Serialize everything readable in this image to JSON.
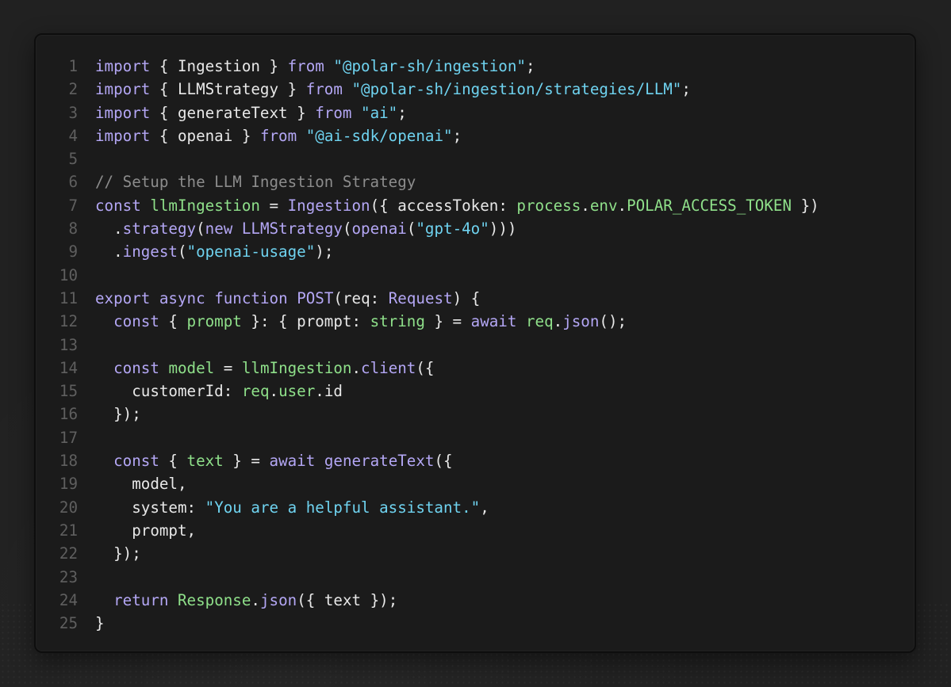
{
  "code": {
    "lines": [
      {
        "n": "1",
        "t": [
          [
            "kw",
            "import"
          ],
          [
            "pn",
            " { "
          ],
          [
            "ident",
            "Ingestion"
          ],
          [
            "pn",
            " } "
          ],
          [
            "kw",
            "from"
          ],
          [
            "pn",
            " "
          ],
          [
            "str",
            "\"@polar-sh/ingestion\""
          ],
          [
            "pn",
            ";"
          ]
        ]
      },
      {
        "n": "2",
        "t": [
          [
            "kw",
            "import"
          ],
          [
            "pn",
            " { "
          ],
          [
            "ident",
            "LLMStrategy"
          ],
          [
            "pn",
            " } "
          ],
          [
            "kw",
            "from"
          ],
          [
            "pn",
            " "
          ],
          [
            "str",
            "\"@polar-sh/ingestion/strategies/LLM\""
          ],
          [
            "pn",
            ";"
          ]
        ]
      },
      {
        "n": "3",
        "t": [
          [
            "kw",
            "import"
          ],
          [
            "pn",
            " { "
          ],
          [
            "ident",
            "generateText"
          ],
          [
            "pn",
            " } "
          ],
          [
            "kw",
            "from"
          ],
          [
            "pn",
            " "
          ],
          [
            "str",
            "\"ai\""
          ],
          [
            "pn",
            ";"
          ]
        ]
      },
      {
        "n": "4",
        "t": [
          [
            "kw",
            "import"
          ],
          [
            "pn",
            " { "
          ],
          [
            "ident",
            "openai"
          ],
          [
            "pn",
            " } "
          ],
          [
            "kw",
            "from"
          ],
          [
            "pn",
            " "
          ],
          [
            "str",
            "\"@ai-sdk/openai\""
          ],
          [
            "pn",
            ";"
          ]
        ]
      },
      {
        "n": "5",
        "t": []
      },
      {
        "n": "6",
        "t": [
          [
            "cm",
            "// Setup the LLM Ingestion Strategy"
          ]
        ]
      },
      {
        "n": "7",
        "t": [
          [
            "kw",
            "const"
          ],
          [
            "pn",
            " "
          ],
          [
            "var",
            "llmIngestion"
          ],
          [
            "pn",
            " = "
          ],
          [
            "call",
            "Ingestion"
          ],
          [
            "pn",
            "({ "
          ],
          [
            "ident",
            "accessToken"
          ],
          [
            "pn",
            ": "
          ],
          [
            "var",
            "process"
          ],
          [
            "pn",
            "."
          ],
          [
            "var",
            "env"
          ],
          [
            "pn",
            "."
          ],
          [
            "var",
            "POLAR_ACCESS_TOKEN"
          ],
          [
            "pn",
            " })"
          ]
        ]
      },
      {
        "n": "8",
        "t": [
          [
            "pn",
            "  ."
          ],
          [
            "call",
            "strategy"
          ],
          [
            "pn",
            "("
          ],
          [
            "kw",
            "new"
          ],
          [
            "pn",
            " "
          ],
          [
            "call",
            "LLMStrategy"
          ],
          [
            "pn",
            "("
          ],
          [
            "call",
            "openai"
          ],
          [
            "pn",
            "("
          ],
          [
            "str",
            "\"gpt-4o\""
          ],
          [
            "pn",
            ")))"
          ]
        ]
      },
      {
        "n": "9",
        "t": [
          [
            "pn",
            "  ."
          ],
          [
            "call",
            "ingest"
          ],
          [
            "pn",
            "("
          ],
          [
            "str",
            "\"openai-usage\""
          ],
          [
            "pn",
            ");"
          ]
        ]
      },
      {
        "n": "10",
        "t": []
      },
      {
        "n": "11",
        "t": [
          [
            "kw",
            "export"
          ],
          [
            "pn",
            " "
          ],
          [
            "kw",
            "async"
          ],
          [
            "pn",
            " "
          ],
          [
            "kw",
            "function"
          ],
          [
            "pn",
            " "
          ],
          [
            "call",
            "POST"
          ],
          [
            "pn",
            "("
          ],
          [
            "ident",
            "req"
          ],
          [
            "pn",
            ": "
          ],
          [
            "call",
            "Request"
          ],
          [
            "pn",
            ") {"
          ]
        ]
      },
      {
        "n": "12",
        "t": [
          [
            "pn",
            "  "
          ],
          [
            "kw",
            "const"
          ],
          [
            "pn",
            " { "
          ],
          [
            "var",
            "prompt"
          ],
          [
            "pn",
            " }: { "
          ],
          [
            "ident",
            "prompt"
          ],
          [
            "pn",
            ": "
          ],
          [
            "var",
            "string"
          ],
          [
            "pn",
            " } = "
          ],
          [
            "kw",
            "await"
          ],
          [
            "pn",
            " "
          ],
          [
            "var",
            "req"
          ],
          [
            "pn",
            "."
          ],
          [
            "call",
            "json"
          ],
          [
            "pn",
            "();"
          ]
        ]
      },
      {
        "n": "13",
        "t": []
      },
      {
        "n": "14",
        "t": [
          [
            "pn",
            "  "
          ],
          [
            "kw",
            "const"
          ],
          [
            "pn",
            " "
          ],
          [
            "var",
            "model"
          ],
          [
            "pn",
            " = "
          ],
          [
            "var",
            "llmIngestion"
          ],
          [
            "pn",
            "."
          ],
          [
            "call",
            "client"
          ],
          [
            "pn",
            "({"
          ]
        ]
      },
      {
        "n": "15",
        "t": [
          [
            "pn",
            "    "
          ],
          [
            "ident",
            "customerId"
          ],
          [
            "pn",
            ": "
          ],
          [
            "var",
            "req"
          ],
          [
            "pn",
            "."
          ],
          [
            "var",
            "user"
          ],
          [
            "pn",
            "."
          ],
          [
            "ident",
            "id"
          ]
        ]
      },
      {
        "n": "16",
        "t": [
          [
            "pn",
            "  });"
          ]
        ]
      },
      {
        "n": "17",
        "t": []
      },
      {
        "n": "18",
        "t": [
          [
            "pn",
            "  "
          ],
          [
            "kw",
            "const"
          ],
          [
            "pn",
            " { "
          ],
          [
            "var",
            "text"
          ],
          [
            "pn",
            " } = "
          ],
          [
            "kw",
            "await"
          ],
          [
            "pn",
            " "
          ],
          [
            "call",
            "generateText"
          ],
          [
            "pn",
            "({"
          ]
        ]
      },
      {
        "n": "19",
        "t": [
          [
            "pn",
            "    "
          ],
          [
            "ident",
            "model"
          ],
          [
            "pn",
            ","
          ]
        ]
      },
      {
        "n": "20",
        "t": [
          [
            "pn",
            "    "
          ],
          [
            "ident",
            "system"
          ],
          [
            "pn",
            ": "
          ],
          [
            "str",
            "\"You are a helpful assistant.\""
          ],
          [
            "pn",
            ","
          ]
        ]
      },
      {
        "n": "21",
        "t": [
          [
            "pn",
            "    "
          ],
          [
            "ident",
            "prompt"
          ],
          [
            "pn",
            ","
          ]
        ]
      },
      {
        "n": "22",
        "t": [
          [
            "pn",
            "  });"
          ]
        ]
      },
      {
        "n": "23",
        "t": []
      },
      {
        "n": "24",
        "t": [
          [
            "pn",
            "  "
          ],
          [
            "kw",
            "return"
          ],
          [
            "pn",
            " "
          ],
          [
            "var",
            "Response"
          ],
          [
            "pn",
            "."
          ],
          [
            "call",
            "json"
          ],
          [
            "pn",
            "({ "
          ],
          [
            "ident",
            "text"
          ],
          [
            "pn",
            " });"
          ]
        ]
      },
      {
        "n": "25",
        "t": [
          [
            "pn",
            "}"
          ]
        ]
      }
    ]
  }
}
